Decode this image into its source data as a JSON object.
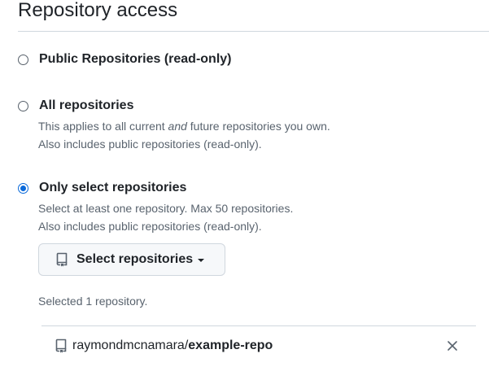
{
  "section": {
    "title": "Repository access"
  },
  "options": [
    {
      "label": "Public Repositories (read-only)",
      "checked": false
    },
    {
      "label": "All repositories",
      "checked": false,
      "note_line1_pre": "This applies to all current ",
      "note_line1_em": "and",
      "note_line1_post": " future repositories you own.",
      "note_line2": "Also includes public repositories (read-only)."
    },
    {
      "label": "Only select repositories",
      "checked": true,
      "note_line1": "Select at least one repository. Max 50 repositories.",
      "note_line2": "Also includes public repositories (read-only)."
    }
  ],
  "select_button": {
    "label": "Select repositories",
    "icon": "repo-icon"
  },
  "selected_summary": "Selected 1 repository.",
  "selected_repos": [
    {
      "owner": "raymondmcnamara/",
      "name": "example-repo",
      "icon": "repo-icon",
      "remove_icon": "x-icon"
    }
  ],
  "colors": {
    "accent": "#0969da",
    "text": "#1f2328",
    "muted": "#59636e",
    "border": "#d0d7de",
    "button_bg": "#f6f8fa"
  }
}
